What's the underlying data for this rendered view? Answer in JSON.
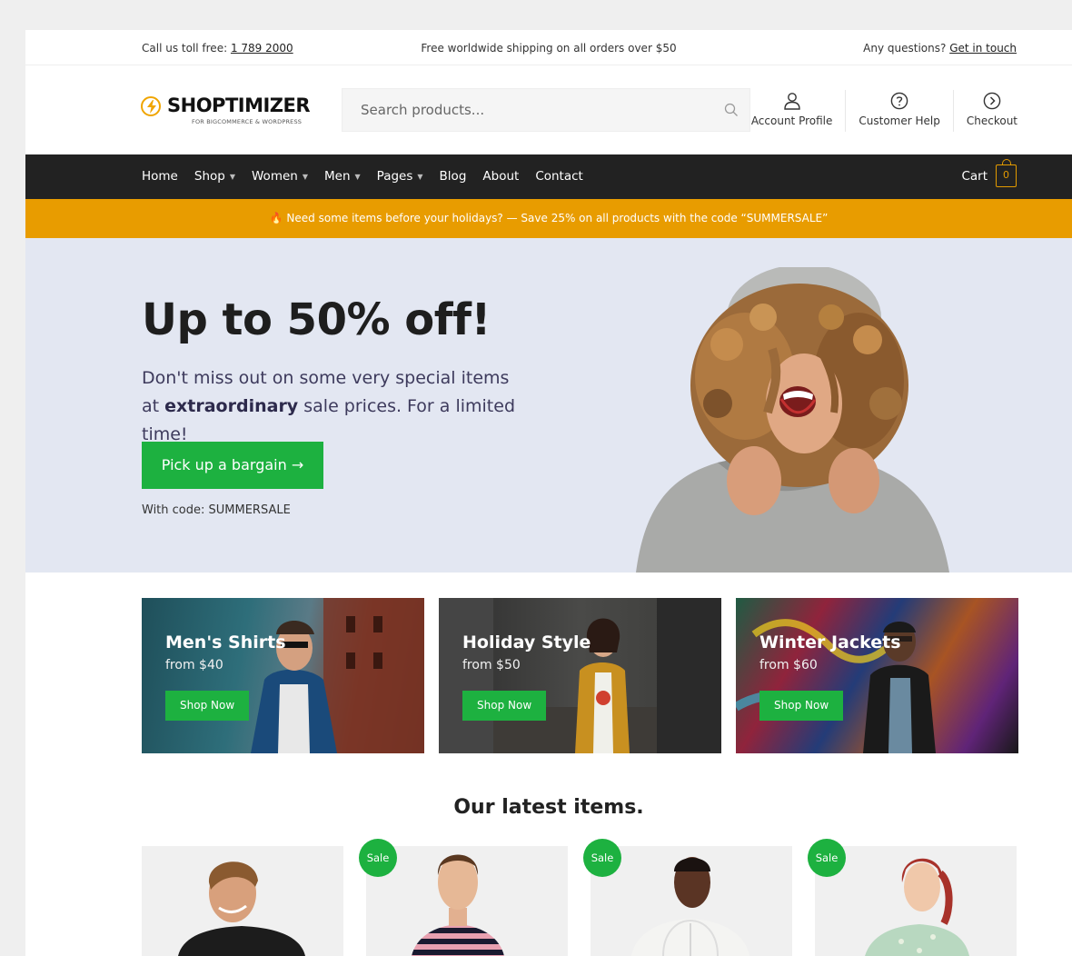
{
  "topbar": {
    "call_text": "Call us toll free:",
    "phone": "1 789 2000",
    "shipping": "Free worldwide shipping on all orders over $50",
    "questions": "Any questions?",
    "get_in_touch": "Get in touch"
  },
  "logo": {
    "name": "SHOPTIMIZER",
    "tagline": "FOR BIGCOMMERCE & WORDPRESS",
    "accent": "#f0a500"
  },
  "search": {
    "placeholder": "Search products..."
  },
  "header_links": [
    {
      "label": "Account Profile",
      "icon": "user-icon"
    },
    {
      "label": "Customer Help",
      "icon": "help-icon"
    },
    {
      "label": "Checkout",
      "icon": "arrow-circle-icon"
    }
  ],
  "nav": {
    "items": [
      {
        "label": "Home"
      },
      {
        "label": "Shop"
      },
      {
        "label": "Women"
      },
      {
        "label": "Men"
      },
      {
        "label": "Pages"
      },
      {
        "label": "Blog"
      },
      {
        "label": "About"
      },
      {
        "label": "Contact"
      }
    ],
    "cart_label": "Cart",
    "cart_count": "0"
  },
  "promo": {
    "text": "🔥 Need some items before your holidays? — Save 25% on all products with the code “SUMMERSALE”",
    "color": "#e89c00"
  },
  "hero": {
    "heading": "Up to 50% off!",
    "desc_start": "Don't miss out on some very special items at ",
    "desc_bold": "extraordinary",
    "desc_end": " sale prices. For a limited time!",
    "cta": "Pick up a bargain →",
    "code": "With code: SUMMERSALE"
  },
  "cards": [
    {
      "title": "Men's Shirts",
      "from": "from $40",
      "button": "Shop Now"
    },
    {
      "title": "Holiday Style",
      "from": "from $50",
      "button": "Shop Now"
    },
    {
      "title": "Winter Jackets",
      "from": "from $60",
      "button": "Shop Now"
    }
  ],
  "latest_heading": "Our latest items.",
  "products": [
    {
      "badge": ""
    },
    {
      "badge": "Sale"
    },
    {
      "badge": "Sale"
    },
    {
      "badge": "Sale"
    }
  ],
  "colors": {
    "green": "#1db140",
    "nav_bg": "#222222",
    "hero_bg": "#e3e7f2"
  }
}
